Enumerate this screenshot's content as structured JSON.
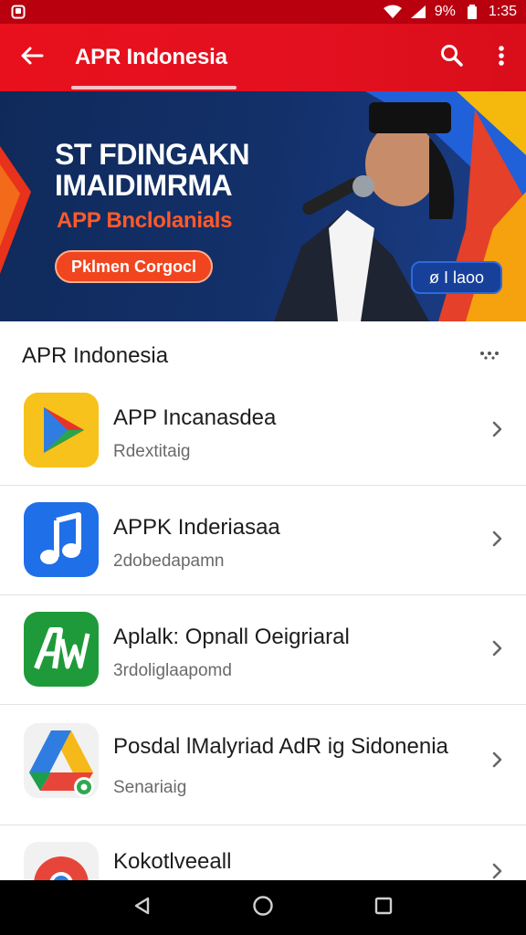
{
  "status_bar": {
    "battery_text": "9%",
    "time": "1:35"
  },
  "app_bar": {
    "title": "APR Indonesia"
  },
  "banner": {
    "headline_line1": "ST FDINGAKN",
    "headline_line2": "IMAIDIMRMA",
    "subtitle": "APP Bnclolanials",
    "cta_label": "Pklmen Corgocl",
    "badge_label": "ø I laoo"
  },
  "section": {
    "title": "APR Indonesia"
  },
  "apps": [
    {
      "title": "APP Incanasdea",
      "subtitle": "Rdextitaig",
      "icon": "play-store-icon"
    },
    {
      "title": "APPK Inderiasaa",
      "subtitle": "2dobedapamn",
      "icon": "music-note-icon"
    },
    {
      "title": "Aplalk: Opnall Oeigriaral",
      "subtitle": "3rdoliglaapomd",
      "icon": "green-letters-icon"
    },
    {
      "title": "Posdal lMalyriad AdR ig Sidonenia",
      "subtitle": "Senariaig",
      "icon": "drive-triangle-icon"
    },
    {
      "title": "Kokotlveeall",
      "subtitle": "",
      "icon": "chrome-icon"
    }
  ],
  "colors": {
    "accent": "#e31020",
    "status_bar": "#b8000f",
    "banner_bg": "#13306a",
    "cta": "#f0451e"
  }
}
